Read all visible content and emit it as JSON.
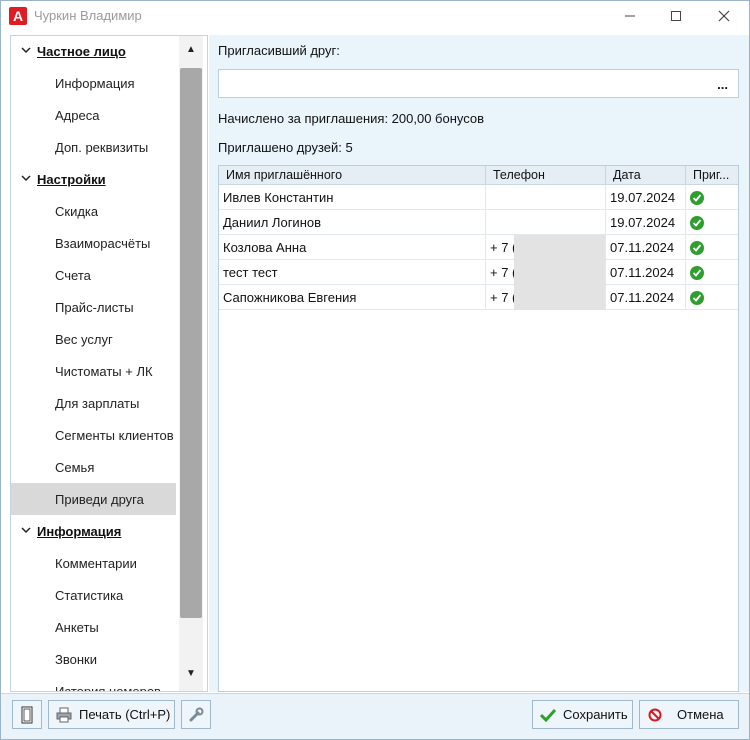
{
  "window": {
    "title": "Чуркин Владимир",
    "app_logo_letter": "A"
  },
  "nav": {
    "items": [
      {
        "label": "Частное лицо",
        "type": "section",
        "expanded": true
      },
      {
        "label": "Информация",
        "type": "sub"
      },
      {
        "label": "Адреса",
        "type": "sub"
      },
      {
        "label": "Доп. реквизиты",
        "type": "sub"
      },
      {
        "label": "Настройки",
        "type": "section",
        "expanded": true
      },
      {
        "label": "Скидка",
        "type": "sub"
      },
      {
        "label": "Взаиморасчёты",
        "type": "sub"
      },
      {
        "label": "Счета",
        "type": "sub"
      },
      {
        "label": "Прайс-листы",
        "type": "sub"
      },
      {
        "label": "Вес услуг",
        "type": "sub"
      },
      {
        "label": "Чистоматы + ЛК",
        "type": "sub"
      },
      {
        "label": "Для зарплаты",
        "type": "sub"
      },
      {
        "label": "Сегменты клиентов",
        "type": "sub"
      },
      {
        "label": "Семья",
        "type": "sub"
      },
      {
        "label": "Приведи друга",
        "type": "sub",
        "active": true
      },
      {
        "label": "Информация",
        "type": "section",
        "expanded": true
      },
      {
        "label": "Комментарии",
        "type": "sub"
      },
      {
        "label": "Статистика",
        "type": "sub"
      },
      {
        "label": "Анкеты",
        "type": "sub"
      },
      {
        "label": "Звонки",
        "type": "sub"
      },
      {
        "label": "История номеров",
        "type": "sub"
      }
    ]
  },
  "referral": {
    "inviter_label": "Пригласивший друг:",
    "inviter_value": "",
    "browse_label": "...",
    "bonus_text": "Начислено за приглашения: 200,00 бонусов",
    "friends_count_text": "Приглашено друзей: 5",
    "table": {
      "columns": [
        "Имя приглашённого",
        "Телефон",
        "Дата",
        "Приг..."
      ],
      "rows": [
        {
          "name": "Ивлев Константин",
          "phone": "",
          "date": "19.07.2024",
          "invited": true
        },
        {
          "name": "Даниил Логинов",
          "phone": "",
          "date": "19.07.2024",
          "invited": true
        },
        {
          "name": "Козлова Анна",
          "phone": "+ 7 (",
          "date": "07.11.2024",
          "invited": true
        },
        {
          "name": "тест тест",
          "phone": "+ 7 (",
          "date": "07.11.2024",
          "invited": true
        },
        {
          "name": "Сапожникова Евгения",
          "phone": "+ 7 (",
          "date": "07.11.2024",
          "invited": true
        }
      ]
    }
  },
  "toolbar": {
    "print_label": "Печать (Ctrl+P)",
    "save_label": "Сохранить",
    "cancel_label": "Отмена"
  },
  "colors": {
    "accent": "#e11b22",
    "panel_bg": "#e9f4fb",
    "check_green": "#2e9e2e",
    "cancel_red": "#d7191f"
  }
}
